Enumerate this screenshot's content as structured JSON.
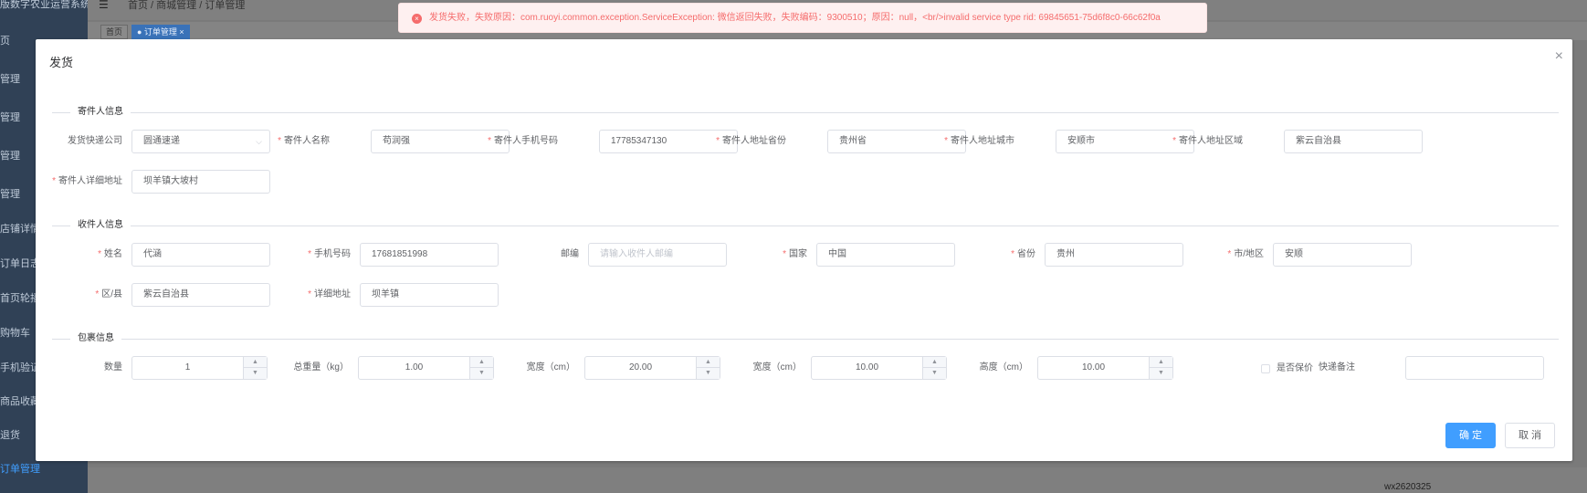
{
  "app": {
    "brand": "版数字农业运营系统",
    "menu": [
      "页",
      "管理",
      "管理",
      "管理",
      "管理",
      "店铺详情",
      "订单日志",
      "首页轮播",
      "购物车",
      "手机验证",
      "商品收藏",
      "退货",
      "订单管理"
    ],
    "breadcrumb": "首页  /  商城管理  /  订单管理",
    "tags": [
      "首页",
      "● 订单管理 ×"
    ],
    "bottom_text": "wx2620325"
  },
  "error_message": "发货失败，失败原因：com.ruoyi.common.exception.ServiceException: 微信返回失败，失败编码：9300510；原因：null，<br/>invalid service type rid: 69845651-75d6f8c0-66c62f0a",
  "dialog": {
    "title": "发货",
    "close": "×",
    "sender": {
      "section": "寄件人信息",
      "express_label": "发货快递公司",
      "express_value": "圆通速递",
      "name_label": "寄件人名称",
      "name_value": "苟润强",
      "phone_label": "寄件人手机号码",
      "phone_value": "17785347130",
      "province_label": "寄件人地址省份",
      "province_value": "贵州省",
      "city_label": "寄件人地址城市",
      "city_value": "安顺市",
      "district_label": "寄件人地址区域",
      "district_value": "紫云自治县",
      "address_label": "寄件人详细地址",
      "address_value": "坝羊镇大坡村"
    },
    "receiver": {
      "section": "收件人信息",
      "name_label": "姓名",
      "name_value": "代涵",
      "phone_label": "手机号码",
      "phone_value": "17681851998",
      "zip_label": "邮编",
      "zip_placeholder": "请输入收件人邮编",
      "country_label": "国家",
      "country_value": "中国",
      "province_label": "省份",
      "province_value": "贵州",
      "city_label": "市/地区",
      "city_value": "安顺",
      "district_label": "区/县",
      "district_value": "紫云自治县",
      "address_label": "详细地址",
      "address_value": "坝羊镇"
    },
    "package": {
      "section": "包裹信息",
      "qty_label": "数量",
      "qty_value": "1",
      "weight_label": "总重量（kg）",
      "weight_value": "1.00",
      "width_label": "宽度（cm）",
      "width_value": "20.00",
      "width2_label": "宽度（cm）",
      "width2_value": "10.00",
      "height_label": "高度（cm）",
      "height_value": "10.00",
      "insured_label": "是否保价",
      "insured_checked": false,
      "remark_label": "快递备注",
      "remark_value": ""
    },
    "confirm": "确 定",
    "cancel": "取 消"
  },
  "colors": {
    "primary": "#409eff",
    "danger": "#f56c6c",
    "sidebar": "#304156"
  },
  "icons": {
    "error": "error-circle-icon",
    "close": "close-icon",
    "caret": "chevron-down-icon",
    "up": "chevron-up-icon",
    "down": "chevron-down-icon"
  }
}
